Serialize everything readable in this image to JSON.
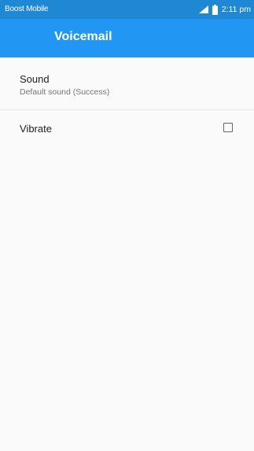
{
  "status_bar": {
    "carrier": "Boost Mobile",
    "time": "2:11 pm",
    "icons": [
      "signal-icon",
      "battery-icon"
    ]
  },
  "app_bar": {
    "title": "Voicemail"
  },
  "preferences": [
    {
      "title": "Sound",
      "summary": "Default sound (Success)"
    },
    {
      "title": "Vibrate",
      "checked": false
    }
  ],
  "colors": {
    "status_bar": "#1e88d4",
    "app_bar": "#2196f3",
    "background": "#fafafa"
  }
}
